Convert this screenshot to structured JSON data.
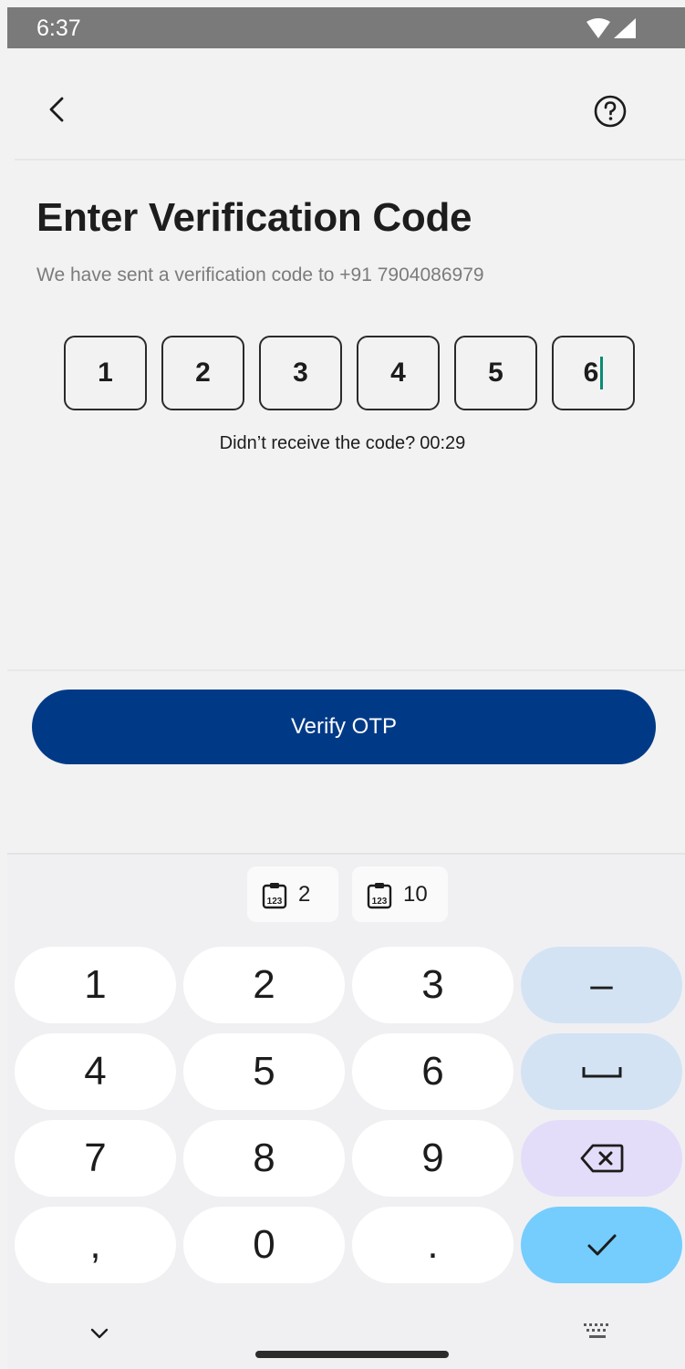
{
  "status_bar": {
    "time": "6:37"
  },
  "header": {
    "back_icon": "chevron-left-icon",
    "help_icon": "help-circle-icon"
  },
  "main": {
    "title": "Enter Verification Code",
    "subtitle": "We have sent a verification code to +91 7904086979",
    "otp_digits": [
      "1",
      "2",
      "3",
      "4",
      "5",
      "6"
    ],
    "resend_text": "Didn’t receive the code?",
    "timer": "00:29",
    "verify_label": "Verify OTP"
  },
  "keyboard": {
    "clipboard_chips": [
      "2",
      "10"
    ],
    "keys": {
      "k1": "1",
      "k2": "2",
      "k3": "3",
      "minus": "–",
      "k4": "4",
      "k5": "5",
      "k6": "6",
      "k7": "7",
      "k8": "8",
      "k9": "9",
      "comma": ",",
      "k0": "0",
      "period": "."
    }
  },
  "colors": {
    "primary": "#003a87",
    "cursor": "#0a8a72",
    "fn_key": "#d3e3f4",
    "backspace_key": "#e3ddfa",
    "enter_key": "#74cdfd"
  }
}
